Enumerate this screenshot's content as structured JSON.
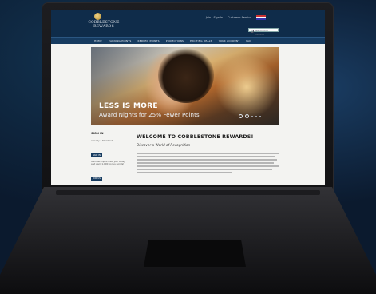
{
  "site": {
    "logo_line1": "COBBLESTONE",
    "logo_line2": "REWARDS",
    "top_links": [
      "Join | Sign In",
      "Customer Service"
    ],
    "search_placeholder": "Search this Website",
    "nav": [
      "HOME",
      "EARNING POINTS",
      "REDEEM POINTS",
      "PROMOTIONS",
      "EXCITING DEALS",
      "YOUR ACCOUNT",
      "FAQ"
    ]
  },
  "hero": {
    "title": "LESS IS MORE",
    "subtitle": "Award Nights for 25% Fewer Points"
  },
  "sidebar": {
    "title": "SIGN IN",
    "prompt": "Already a Member?",
    "signin_button": "SIGN IN",
    "join_prompt": "Membership is free! Join today and earn 1,000 bonus points!",
    "join_button": "JOIN US"
  },
  "main": {
    "title": "WELCOME TO COBBLESTONE REWARDS!",
    "subtitle": "Discover a World of Recognition"
  },
  "colors": {
    "header": "#0f2c4a",
    "nav": "#163b60",
    "background": "#0b1a2e"
  }
}
